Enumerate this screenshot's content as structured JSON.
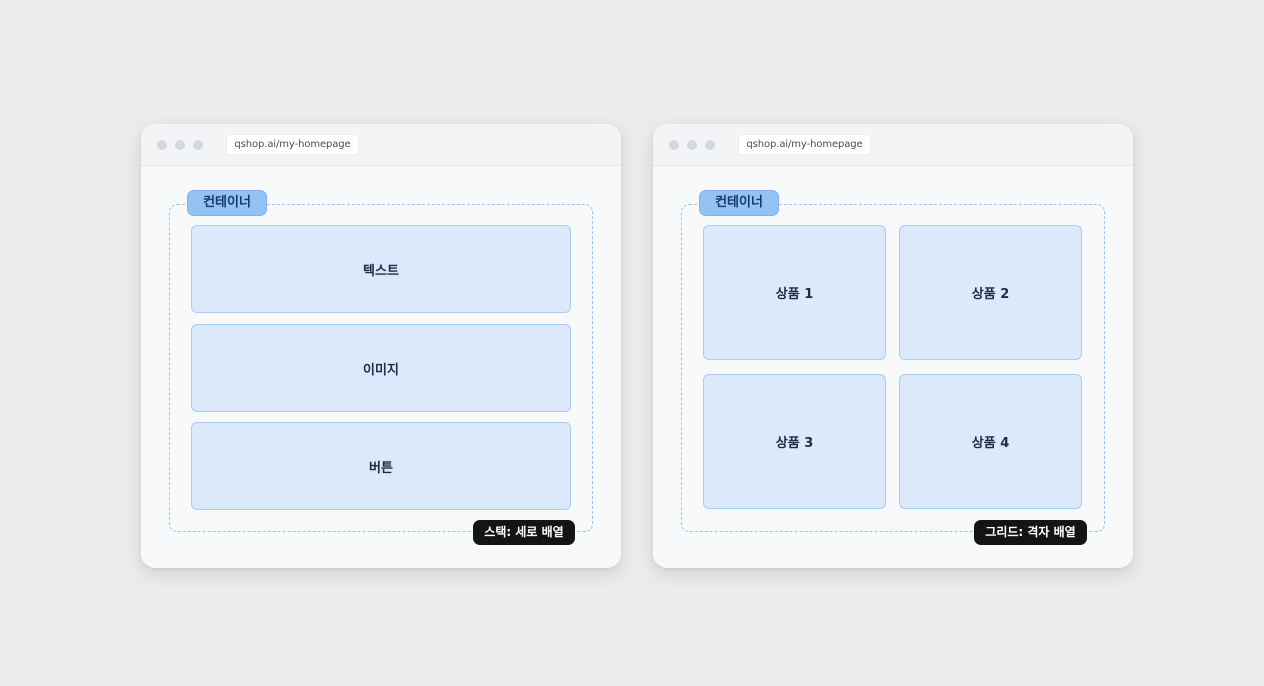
{
  "windows": [
    {
      "url": "qshop.ai/my-homepage",
      "container_label": "컨테이너",
      "layout": "stack",
      "items": [
        "텍스트",
        "이미지",
        "버튼"
      ],
      "caption": "스택: 세로 배열"
    },
    {
      "url": "qshop.ai/my-homepage",
      "container_label": "컨테이너",
      "layout": "grid",
      "items": [
        "상품 1",
        "상품 2",
        "상품 3",
        "상품 4"
      ],
      "caption": "그리드: 격자 배열"
    }
  ],
  "colors": {
    "background": "#ececec",
    "block_fill": "#dbe9fb",
    "chip_fill": "#93c2f5",
    "dashed_border": "#9cc3ec",
    "caption_fill": "#141414"
  }
}
